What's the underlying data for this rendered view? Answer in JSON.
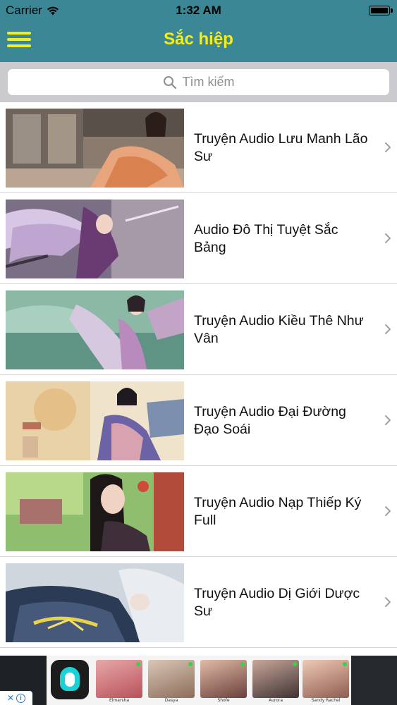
{
  "status_bar": {
    "carrier": "Carrier",
    "time": "1:32 AM",
    "battery_level": 1.0
  },
  "nav": {
    "title": "Sắc hiệp",
    "title_color": "#f2ee1e",
    "bar_color": "#3b8796",
    "menu_icon": "hamburger-menu-icon"
  },
  "search": {
    "placeholder": "Tìm kiếm",
    "icon": "search-icon"
  },
  "stories": [
    {
      "title": "Truyện Audio Lưu Manh Lão Sư"
    },
    {
      "title": "Audio Đô Thị Tuyệt Sắc Bảng"
    },
    {
      "title": "Truyện Audio Kiều Thê Như Vân"
    },
    {
      "title": "Truyện Audio Đại Đường Đạo Soái"
    },
    {
      "title": "Truyện Audio Nạp Thiếp Ký Full"
    },
    {
      "title": "Truyện Audio Dị Giới Dược Sư"
    }
  ],
  "ad": {
    "close_x": "✕",
    "info": "i",
    "profiles": [
      {
        "name": "Elmarsha"
      },
      {
        "name": "Dasya"
      },
      {
        "name": "Shofe"
      },
      {
        "name": "Aurora"
      },
      {
        "name": "Sandy Rachel"
      }
    ]
  }
}
